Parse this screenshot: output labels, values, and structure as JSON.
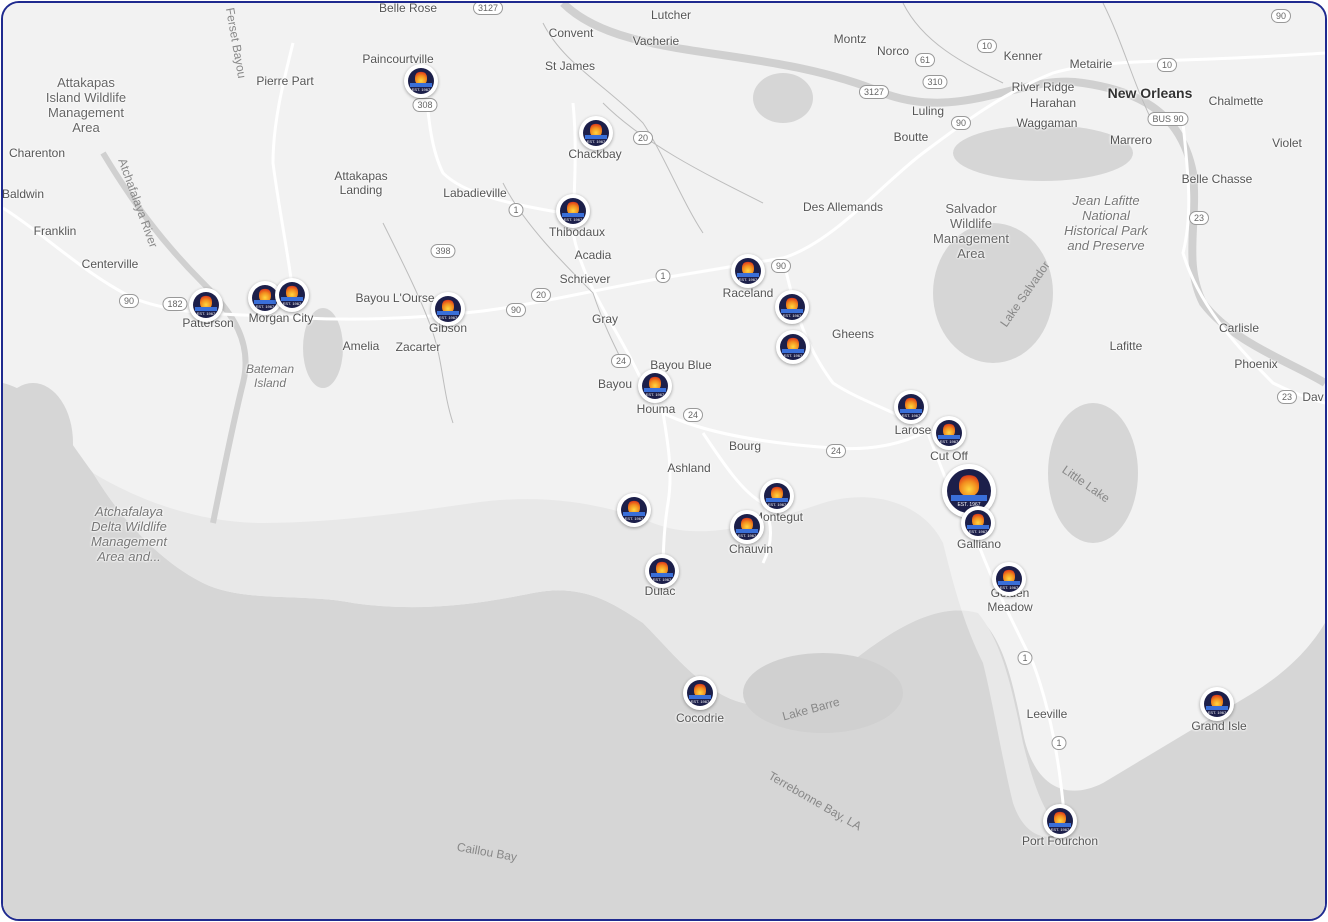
{
  "map": {
    "colors": {
      "land": "#f2f2f2",
      "water": "#d6d6d6",
      "road": "#ffffff",
      "marsh": "#e6e6e6",
      "frame": "#1f2a8f"
    },
    "place_labels": [
      {
        "text": "Belle Rose",
        "style": "normal"
      },
      {
        "text": "Lutcher",
        "style": "normal"
      },
      {
        "text": "Convent",
        "style": "normal"
      },
      {
        "text": "Vacherie",
        "style": "normal"
      },
      {
        "text": "Montz",
        "style": "normal"
      },
      {
        "text": "Norco",
        "style": "normal"
      },
      {
        "text": "Kenner",
        "style": "normal"
      },
      {
        "text": "Metairie",
        "style": "normal"
      },
      {
        "text": "River Ridge",
        "style": "normal"
      },
      {
        "text": "Harahan",
        "style": "normal"
      },
      {
        "text": "New Orleans",
        "style": "big"
      },
      {
        "text": "Chalmette",
        "style": "normal"
      },
      {
        "text": "Waggaman",
        "style": "normal"
      },
      {
        "text": "Marrero",
        "style": "normal"
      },
      {
        "text": "Violet",
        "style": "normal"
      },
      {
        "text": "Luling",
        "style": "normal"
      },
      {
        "text": "Boutte",
        "style": "normal"
      },
      {
        "text": "St James",
        "style": "normal"
      },
      {
        "text": "Paincourtville",
        "style": "normal"
      },
      {
        "text": "Pierre Part",
        "style": "normal"
      },
      {
        "text": "Attakapas\nIsland Wildlife\nManagement\nArea",
        "style": "park"
      },
      {
        "text": "Charenton",
        "style": "normal"
      },
      {
        "text": "Baldwin",
        "style": "normal"
      },
      {
        "text": "Franklin",
        "style": "normal"
      },
      {
        "text": "Centerville",
        "style": "normal"
      },
      {
        "text": "Attakapas\nLanding",
        "style": "normal"
      },
      {
        "text": "Labadieville",
        "style": "normal"
      },
      {
        "text": "Chackbay",
        "style": "normal"
      },
      {
        "text": "Thibodaux",
        "style": "normal"
      },
      {
        "text": "Acadia",
        "style": "normal"
      },
      {
        "text": "Schriever",
        "style": "normal"
      },
      {
        "text": "Des Allemands",
        "style": "normal"
      },
      {
        "text": "Salvador\nWildlife\nManagement\nArea",
        "style": "park"
      },
      {
        "text": "Jean Lafitte\nNational\nHistorical Park\nand Preserve",
        "style": "park-italic"
      },
      {
        "text": "Belle Chasse",
        "style": "normal"
      },
      {
        "text": "Raceland",
        "style": "normal"
      },
      {
        "text": "Bayou L'Ourse",
        "style": "normal"
      },
      {
        "text": "Gibson",
        "style": "normal"
      },
      {
        "text": "Patterson",
        "style": "normal"
      },
      {
        "text": "Morgan City",
        "style": "normal"
      },
      {
        "text": "Amelia",
        "style": "normal"
      },
      {
        "text": "Zacarter",
        "style": "normal"
      },
      {
        "text": "Bateman\nIsland",
        "style": "italic"
      },
      {
        "text": "Gray",
        "style": "normal"
      },
      {
        "text": "Gheens",
        "style": "normal"
      },
      {
        "text": "Lafitte",
        "style": "normal"
      },
      {
        "text": "Carlisle",
        "style": "normal"
      },
      {
        "text": "Phoenix",
        "style": "normal"
      },
      {
        "text": "Dav",
        "style": "normal"
      },
      {
        "text": "Bayou Blue",
        "style": "normal"
      },
      {
        "text": "Bayou",
        "style": "normal"
      },
      {
        "text": "Houma",
        "style": "normal"
      },
      {
        "text": "Larose",
        "style": "normal"
      },
      {
        "text": "Cut Off",
        "style": "normal"
      },
      {
        "text": "Bourg",
        "style": "normal"
      },
      {
        "text": "Ashland",
        "style": "normal"
      },
      {
        "text": "Montegut",
        "style": "normal"
      },
      {
        "text": "Chauvin",
        "style": "normal"
      },
      {
        "text": "Galliano",
        "style": "normal"
      },
      {
        "text": "Golden\nMeadow",
        "style": "normal"
      },
      {
        "text": "Dulac",
        "style": "normal"
      },
      {
        "text": "Atchafalaya\nDelta Wildlife\nManagement\nArea and...",
        "style": "park-italic"
      },
      {
        "text": "Cocodrie",
        "style": "normal"
      },
      {
        "text": "Leeville",
        "style": "normal"
      },
      {
        "text": "Grand Isle",
        "style": "normal"
      },
      {
        "text": "Port Fourchon",
        "style": "normal"
      },
      {
        "text": "Lake Salvador",
        "style": "water-rot"
      },
      {
        "text": "Little Lake",
        "style": "water-rot2"
      },
      {
        "text": "Lake Barre",
        "style": "water-rot3"
      },
      {
        "text": "Terrebonne Bay, LA",
        "style": "water-rot4"
      },
      {
        "text": "Caillou Bay",
        "style": "water-rot5"
      },
      {
        "text": "Atchafalaya River",
        "style": "water-rot6"
      },
      {
        "text": "Ferset Bayou",
        "style": "water-rot7"
      }
    ],
    "route_shields": [
      "3127",
      "90",
      "10",
      "10",
      "61",
      "310",
      "3127",
      "90",
      "BUS 90",
      "308",
      "20",
      "1",
      "398",
      "90",
      "182",
      "90",
      "20",
      "1",
      "90",
      "24",
      "24",
      "24",
      "1",
      "1",
      "23",
      "23"
    ],
    "markers": [
      {
        "name": "Paincourtville",
        "size": "small"
      },
      {
        "name": "Chackbay",
        "size": "small"
      },
      {
        "name": "Thibodaux",
        "size": "small"
      },
      {
        "name": "Patterson",
        "size": "small"
      },
      {
        "name": "Morgan City West",
        "size": "small"
      },
      {
        "name": "Morgan City",
        "size": "small"
      },
      {
        "name": "Gibson",
        "size": "small"
      },
      {
        "name": "Raceland",
        "size": "small"
      },
      {
        "name": "Raceland South",
        "size": "small"
      },
      {
        "name": "Gheens",
        "size": "small"
      },
      {
        "name": "Houma",
        "size": "small"
      },
      {
        "name": "Larose",
        "size": "small"
      },
      {
        "name": "Cut Off",
        "size": "small"
      },
      {
        "name": "Galliano HQ",
        "size": "large"
      },
      {
        "name": "Galliano",
        "size": "small"
      },
      {
        "name": "Golden Meadow",
        "size": "small"
      },
      {
        "name": "Montegut",
        "size": "small"
      },
      {
        "name": "Chauvin",
        "size": "small"
      },
      {
        "name": "Ashland West",
        "size": "small"
      },
      {
        "name": "Dulac",
        "size": "small"
      },
      {
        "name": "Cocodrie",
        "size": "small"
      },
      {
        "name": "Grand Isle",
        "size": "small"
      },
      {
        "name": "Port Fourchon",
        "size": "small"
      }
    ],
    "marker_badge": {
      "brand_text": "MARTIN'S A/C & ELECTRIC",
      "est_text": "EST. 1967"
    }
  }
}
